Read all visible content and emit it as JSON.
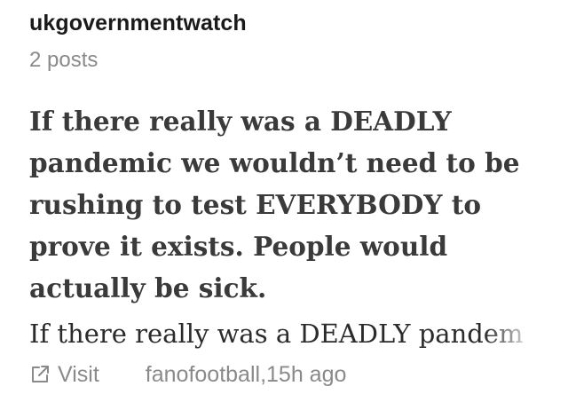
{
  "feed": {
    "username": "ukgovernmentwatch",
    "post_count": "2 posts"
  },
  "post": {
    "title": "If there really was a DEADLY pandemic we wouldn’t need to be rushing to test EVERYBODY to prove it exists. People would actually be sick.",
    "excerpt": "If there really was a DEADLY pandem",
    "visit_label": "Visit",
    "author": "fanofootball",
    "separator": ", ",
    "time_ago": "15h ago"
  },
  "icons": {
    "visit": "external-link-icon"
  },
  "colors": {
    "username": "#1a1a1a",
    "muted": "#8a8a8a",
    "title": "#3a3a3a",
    "excerpt": "#2b2b2b",
    "background": "#ffffff"
  }
}
